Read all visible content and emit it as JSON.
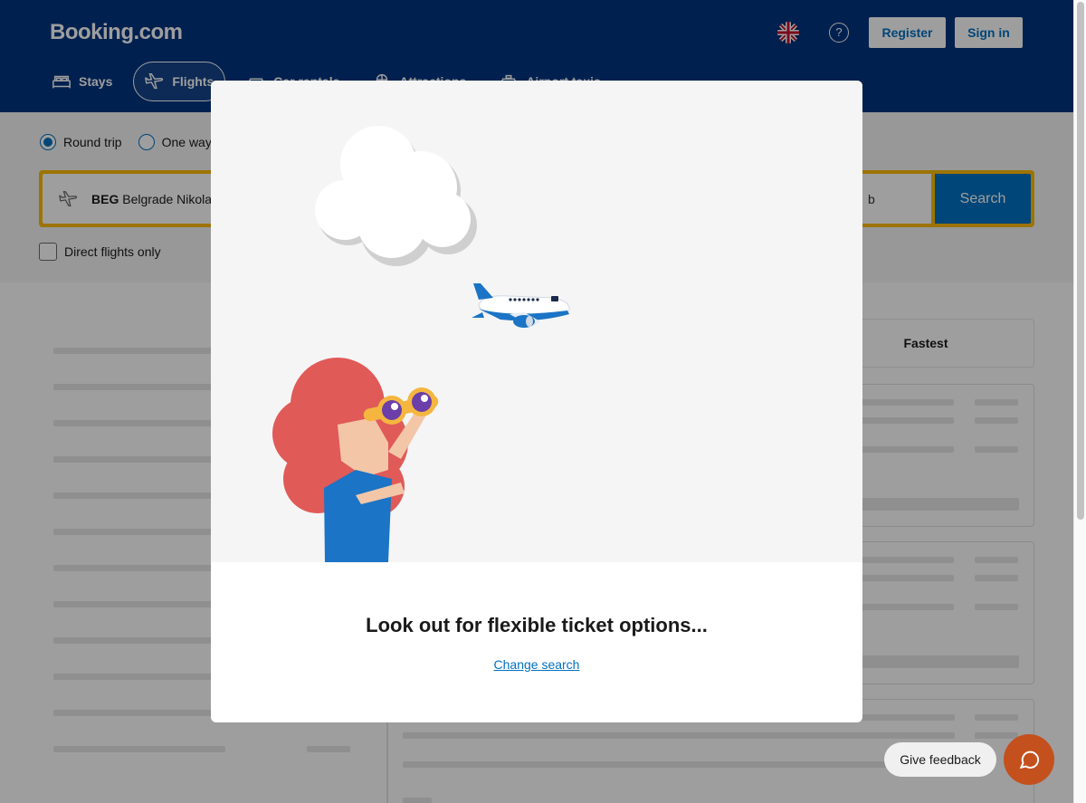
{
  "header": {
    "logo": "Booking.com",
    "register_label": "Register",
    "signin_label": "Sign in",
    "help_glyph": "?"
  },
  "nav": [
    {
      "label": "Stays",
      "icon": "bed-icon"
    },
    {
      "label": "Flights",
      "icon": "plane-icon",
      "active": true
    },
    {
      "label": "Car rentals",
      "icon": "car-icon"
    },
    {
      "label": "Attractions",
      "icon": "attractions-icon"
    },
    {
      "label": "Airport taxis",
      "icon": "taxi-icon"
    }
  ],
  "search": {
    "trip_types": [
      "Round trip",
      "One way"
    ],
    "selected_trip": "Round trip",
    "from_code": "BEG",
    "from_name": "Belgrade Nikola",
    "to_visible": "b",
    "search_label": "Search",
    "direct_only_label": "Direct flights only"
  },
  "sort": {
    "fastest_label": "Fastest"
  },
  "modal": {
    "title": "Look out for flexible ticket options...",
    "link": "Change search"
  },
  "feedback": {
    "label": "Give feedback"
  },
  "colors": {
    "brand": "#003580",
    "accent": "#0071c2",
    "search_border": "#febb02",
    "chat": "#c4501e"
  }
}
